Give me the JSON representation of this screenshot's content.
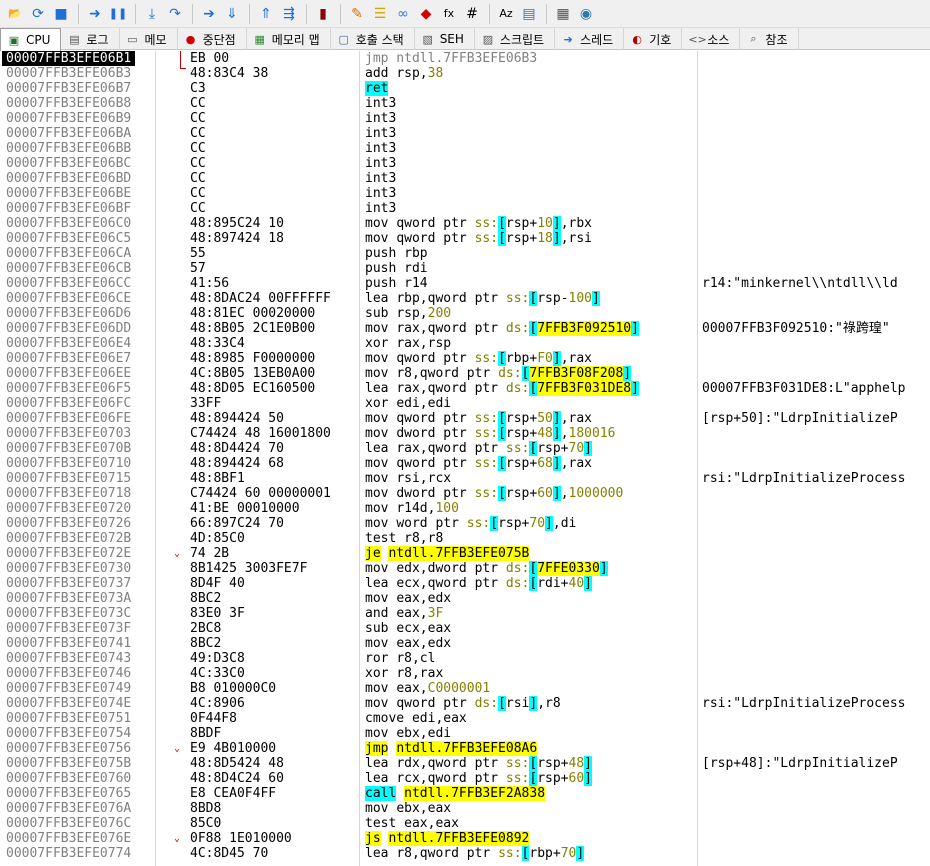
{
  "toolbar": {
    "icons": [
      "open-icon",
      "restart-icon",
      "stop-icon",
      "run-icon",
      "pause-icon",
      "step-into-icon",
      "step-over-icon",
      "trace-into-icon",
      "trace-over-icon",
      "execute-till-return-icon",
      "run-to-user-code-icon",
      "scylla-icon",
      "patch-icon",
      "comment-icon",
      "link-icon",
      "label-icon",
      "formula-fx-icon",
      "hash-icon",
      "font-icon",
      "properties-icon",
      "calculator-icon",
      "globe-icon"
    ]
  },
  "tabs": [
    {
      "label": "CPU",
      "icon": "cpu-icon",
      "active": true
    },
    {
      "label": "로그",
      "icon": "log-icon"
    },
    {
      "label": "메모",
      "icon": "notes-icon"
    },
    {
      "label": "중단점",
      "icon": "breakpoint-icon"
    },
    {
      "label": "메모리 맵",
      "icon": "memory-map-icon"
    },
    {
      "label": "호출 스택",
      "icon": "call-stack-icon"
    },
    {
      "label": "SEH",
      "icon": "seh-icon"
    },
    {
      "label": "스크립트",
      "icon": "script-icon"
    },
    {
      "label": "스레드",
      "icon": "threads-icon"
    },
    {
      "label": "기호",
      "icon": "symbols-icon"
    },
    {
      "label": "소스",
      "icon": "source-icon"
    },
    {
      "label": "참조",
      "icon": "references-icon"
    }
  ],
  "colors": {
    "current_addr_bg": "#000000",
    "highlight_cyan": "#00ffff",
    "highlight_yellow": "#ffff00",
    "arrow_red": "#c00000"
  },
  "rows": [
    {
      "addr": "00007FFB3EFE06B1",
      "bytes": "EB 00",
      "instr": "jmp ntdll.7FFB3EFE06B3",
      "comment": "",
      "current": true,
      "dim": true
    },
    {
      "addr": "00007FFB3EFE06B3",
      "bytes": "48:83C4 38",
      "instr": "add rsp,38",
      "comment": ""
    },
    {
      "addr": "00007FFB3EFE06B7",
      "bytes": "C3",
      "instr": "ret",
      "comment": "",
      "hl": "ret"
    },
    {
      "addr": "00007FFB3EFE06B8",
      "bytes": "CC",
      "instr": "int3",
      "comment": ""
    },
    {
      "addr": "00007FFB3EFE06B9",
      "bytes": "CC",
      "instr": "int3",
      "comment": ""
    },
    {
      "addr": "00007FFB3EFE06BA",
      "bytes": "CC",
      "instr": "int3",
      "comment": ""
    },
    {
      "addr": "00007FFB3EFE06BB",
      "bytes": "CC",
      "instr": "int3",
      "comment": ""
    },
    {
      "addr": "00007FFB3EFE06BC",
      "bytes": "CC",
      "instr": "int3",
      "comment": ""
    },
    {
      "addr": "00007FFB3EFE06BD",
      "bytes": "CC",
      "instr": "int3",
      "comment": ""
    },
    {
      "addr": "00007FFB3EFE06BE",
      "bytes": "CC",
      "instr": "int3",
      "comment": ""
    },
    {
      "addr": "00007FFB3EFE06BF",
      "bytes": "CC",
      "instr": "int3",
      "comment": ""
    },
    {
      "addr": "00007FFB3EFE06C0",
      "bytes": "48:895C24 10",
      "instr": "mov qword ptr ss:[rsp+10],rbx",
      "comment": ""
    },
    {
      "addr": "00007FFB3EFE06C5",
      "bytes": "48:897424 18",
      "instr": "mov qword ptr ss:[rsp+18],rsi",
      "comment": ""
    },
    {
      "addr": "00007FFB3EFE06CA",
      "bytes": "55",
      "instr": "push rbp",
      "comment": ""
    },
    {
      "addr": "00007FFB3EFE06CB",
      "bytes": "57",
      "instr": "push rdi",
      "comment": ""
    },
    {
      "addr": "00007FFB3EFE06CC",
      "bytes": "41:56",
      "instr": "push r14",
      "comment": "r14:\"minkernel\\\\ntdll\\\\ld"
    },
    {
      "addr": "00007FFB3EFE06CE",
      "bytes": "48:8DAC24 00FFFFFF",
      "instr": "lea rbp,qword ptr ss:[rsp-100]",
      "comment": ""
    },
    {
      "addr": "00007FFB3EFE06D6",
      "bytes": "48:81EC 00020000",
      "instr": "sub rsp,200",
      "comment": ""
    },
    {
      "addr": "00007FFB3EFE06DD",
      "bytes": "48:8B05 2C1E0B00",
      "instr": "mov rax,qword ptr ds:[7FFB3F092510]",
      "comment": "00007FFB3F092510:\"祿跨瑝\""
    },
    {
      "addr": "00007FFB3EFE06E4",
      "bytes": "48:33C4",
      "instr": "xor rax,rsp",
      "comment": ""
    },
    {
      "addr": "00007FFB3EFE06E7",
      "bytes": "48:8985 F0000000",
      "instr": "mov qword ptr ss:[rbp+F0],rax",
      "comment": ""
    },
    {
      "addr": "00007FFB3EFE06EE",
      "bytes": "4C:8B05 13EB0A00",
      "instr": "mov r8,qword ptr ds:[7FFB3F08F208]",
      "comment": ""
    },
    {
      "addr": "00007FFB3EFE06F5",
      "bytes": "48:8D05 EC160500",
      "instr": "lea rax,qword ptr ds:[7FFB3F031DE8]",
      "comment": "00007FFB3F031DE8:L\"apphelp"
    },
    {
      "addr": "00007FFB3EFE06FC",
      "bytes": "33FF",
      "instr": "xor edi,edi",
      "comment": ""
    },
    {
      "addr": "00007FFB3EFE06FE",
      "bytes": "48:894424 50",
      "instr": "mov qword ptr ss:[rsp+50],rax",
      "comment": "[rsp+50]:\"LdrpInitializeP"
    },
    {
      "addr": "00007FFB3EFE0703",
      "bytes": "C74424 48 16001800",
      "instr": "mov dword ptr ss:[rsp+48],180016",
      "comment": ""
    },
    {
      "addr": "00007FFB3EFE070B",
      "bytes": "48:8D4424 70",
      "instr": "lea rax,qword ptr ss:[rsp+70]",
      "comment": ""
    },
    {
      "addr": "00007FFB3EFE0710",
      "bytes": "48:894424 68",
      "instr": "mov qword ptr ss:[rsp+68],rax",
      "comment": ""
    },
    {
      "addr": "00007FFB3EFE0715",
      "bytes": "48:8BF1",
      "instr": "mov rsi,rcx",
      "comment": "rsi:\"LdrpInitializeProcess"
    },
    {
      "addr": "00007FFB3EFE0718",
      "bytes": "C74424 60 00000001",
      "instr": "mov dword ptr ss:[rsp+60],1000000",
      "comment": ""
    },
    {
      "addr": "00007FFB3EFE0720",
      "bytes": "41:BE 00010000",
      "instr": "mov r14d,100",
      "comment": ""
    },
    {
      "addr": "00007FFB3EFE0726",
      "bytes": "66:897C24 70",
      "instr": "mov word ptr ss:[rsp+70],di",
      "comment": ""
    },
    {
      "addr": "00007FFB3EFE072B",
      "bytes": "4D:85C0",
      "instr": "test r8,r8",
      "comment": ""
    },
    {
      "addr": "00007FFB3EFE072E",
      "bytes": "74 2B",
      "instr": "je ntdll.7FFB3EFE075B",
      "comment": "",
      "hl": "jmp",
      "arrow": "⌄"
    },
    {
      "addr": "00007FFB3EFE0730",
      "bytes": "8B1425 3003FE7F",
      "instr": "mov edx,dword ptr ds:[7FFE0330]",
      "comment": ""
    },
    {
      "addr": "00007FFB3EFE0737",
      "bytes": "8D4F 40",
      "instr": "lea ecx,qword ptr ds:[rdi+40]",
      "comment": ""
    },
    {
      "addr": "00007FFB3EFE073A",
      "bytes": "8BC2",
      "instr": "mov eax,edx",
      "comment": ""
    },
    {
      "addr": "00007FFB3EFE073C",
      "bytes": "83E0 3F",
      "instr": "and eax,3F",
      "comment": ""
    },
    {
      "addr": "00007FFB3EFE073F",
      "bytes": "2BC8",
      "instr": "sub ecx,eax",
      "comment": ""
    },
    {
      "addr": "00007FFB3EFE0741",
      "bytes": "8BC2",
      "instr": "mov eax,edx",
      "comment": ""
    },
    {
      "addr": "00007FFB3EFE0743",
      "bytes": "49:D3C8",
      "instr": "ror r8,cl",
      "comment": ""
    },
    {
      "addr": "00007FFB3EFE0746",
      "bytes": "4C:33C0",
      "instr": "xor r8,rax",
      "comment": ""
    },
    {
      "addr": "00007FFB3EFE0749",
      "bytes": "B8 010000C0",
      "instr": "mov eax,C0000001",
      "comment": ""
    },
    {
      "addr": "00007FFB3EFE074E",
      "bytes": "4C:8906",
      "instr": "mov qword ptr ds:[rsi],r8",
      "comment": "rsi:\"LdrpInitializeProcess"
    },
    {
      "addr": "00007FFB3EFE0751",
      "bytes": "0F44F8",
      "instr": "cmove edi,eax",
      "comment": ""
    },
    {
      "addr": "00007FFB3EFE0754",
      "bytes": "8BDF",
      "instr": "mov ebx,edi",
      "comment": ""
    },
    {
      "addr": "00007FFB3EFE0756",
      "bytes": "E9 4B010000",
      "instr": "jmp ntdll.7FFB3EFE08A6",
      "comment": "",
      "hl": "jmp",
      "arrow": "⌄"
    },
    {
      "addr": "00007FFB3EFE075B",
      "bytes": "48:8D5424 48",
      "instr": "lea rdx,qword ptr ss:[rsp+48]",
      "comment": "[rsp+48]:\"LdrpInitializeP"
    },
    {
      "addr": "00007FFB3EFE0760",
      "bytes": "48:8D4C24 60",
      "instr": "lea rcx,qword ptr ss:[rsp+60]",
      "comment": ""
    },
    {
      "addr": "00007FFB3EFE0765",
      "bytes": "E8 CEA0F4FF",
      "instr": "call ntdll.7FFB3EF2A838",
      "comment": "",
      "hl": "call"
    },
    {
      "addr": "00007FFB3EFE076A",
      "bytes": "8BD8",
      "instr": "mov ebx,eax",
      "comment": ""
    },
    {
      "addr": "00007FFB3EFE076C",
      "bytes": "85C0",
      "instr": "test eax,eax",
      "comment": ""
    },
    {
      "addr": "00007FFB3EFE076E",
      "bytes": "0F88 1E010000",
      "instr": "js ntdll.7FFB3EFE0892",
      "comment": "",
      "hl": "jmp",
      "arrow": "⌄"
    },
    {
      "addr": "00007FFB3EFE0774",
      "bytes": "4C:8D45 70",
      "instr": "lea r8,qword ptr ss:[rbp+70]",
      "comment": ""
    }
  ]
}
